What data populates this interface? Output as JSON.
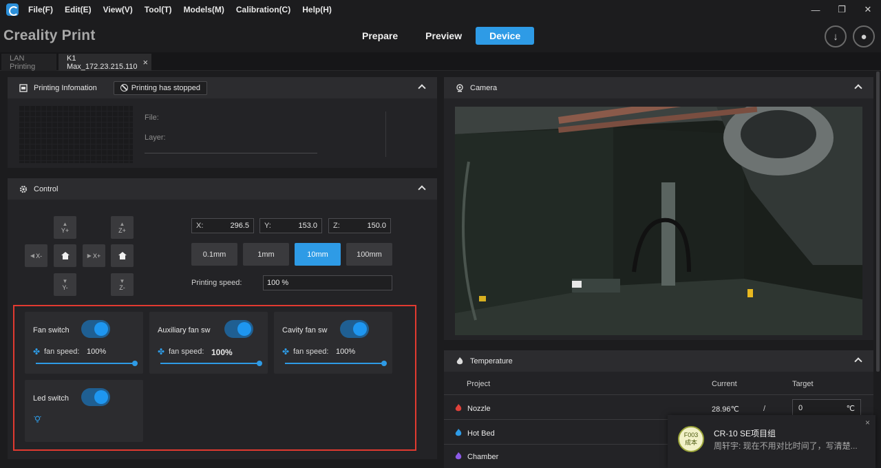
{
  "menu": {
    "items": [
      "File(F)",
      "Edit(E)",
      "View(V)",
      "Tool(T)",
      "Models(M)",
      "Calibration(C)",
      "Help(H)"
    ]
  },
  "window": {
    "minimize": "—",
    "maximize": "❐",
    "close": "✕"
  },
  "header": {
    "brand": "Creality Print",
    "tabs": [
      "Prepare",
      "Preview",
      "Device"
    ],
    "active_tab": "Device",
    "download_glyph": "↓",
    "user_glyph": "●"
  },
  "subtabs": {
    "lan": "LAN Printing",
    "device": "K1 Max_172.23.215.110",
    "close": "×"
  },
  "printing_info": {
    "title": "Printing Infomation",
    "status": "Printing has stopped",
    "file_label": "File:",
    "layer_label": "Layer:"
  },
  "control": {
    "title": "Control",
    "jog": {
      "y_plus": "Y+",
      "y_minus": "Y-",
      "x_minus": "X-",
      "x_plus": "X+",
      "z_plus": "Z+",
      "z_minus": "Z-"
    },
    "coords": [
      {
        "label": "X:",
        "value": "296.5"
      },
      {
        "label": "Y:",
        "value": "153.0"
      },
      {
        "label": "Z:",
        "value": "150.0"
      }
    ],
    "steps": [
      "0.1mm",
      "1mm",
      "10mm",
      "100mm"
    ],
    "active_step": "10mm",
    "speed_label": "Printing speed:",
    "speed_value": "100 %"
  },
  "fans": [
    {
      "name": "Fan switch",
      "speed_label": "fan speed:",
      "speed": "100%",
      "speed_fraction": 1.0,
      "on": true
    },
    {
      "name": "Auxiliary fan sw",
      "speed_label": "fan speed:",
      "speed": "100%",
      "speed_fraction": 1.0,
      "on": true
    },
    {
      "name": "Cavity fan sw",
      "speed_label": "fan speed:",
      "speed": "100%",
      "speed_fraction": 1.0,
      "on": true
    }
  ],
  "led": {
    "name": "Led switch",
    "on": true
  },
  "camera": {
    "title": "Camera"
  },
  "temperature": {
    "title": "Temperature",
    "columns": {
      "project": "Project",
      "current": "Current",
      "target": "Target"
    },
    "rows": [
      {
        "name": "Nozzle",
        "current": "28.96℃",
        "slash": "/",
        "target": "0",
        "unit": "℃",
        "color": "#e0413a"
      },
      {
        "name": "Hot Bed",
        "color": "#2e9be6"
      },
      {
        "name": "Chamber",
        "color": "#8c5ae6"
      }
    ]
  },
  "toast": {
    "avatar_line1": "F003",
    "avatar_line2": "成本",
    "title": "CR-10 SE项目组",
    "message": "周轩宇: 现在不用对比时间了，写清楚...",
    "close": "×"
  },
  "colors": {
    "accent": "#2e9be6",
    "alert_border": "#e23a30"
  }
}
